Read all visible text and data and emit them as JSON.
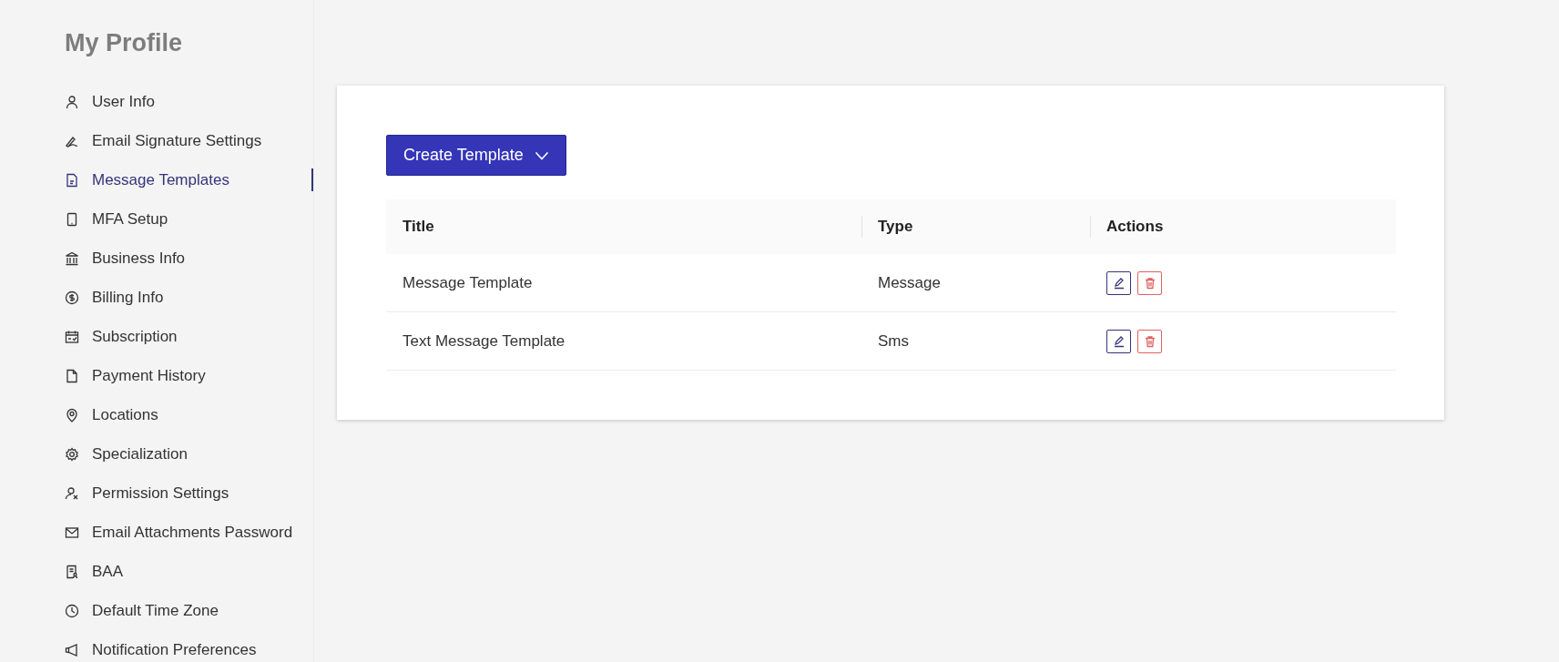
{
  "page_title": "My Profile",
  "sidebar": {
    "items": [
      {
        "label": "User Info",
        "selected": false
      },
      {
        "label": "Email Signature Settings",
        "selected": false
      },
      {
        "label": "Message Templates",
        "selected": true
      },
      {
        "label": "MFA Setup",
        "selected": false
      },
      {
        "label": "Business Info",
        "selected": false
      },
      {
        "label": "Billing Info",
        "selected": false
      },
      {
        "label": "Subscription",
        "selected": false
      },
      {
        "label": "Payment History",
        "selected": false
      },
      {
        "label": "Locations",
        "selected": false
      },
      {
        "label": "Specialization",
        "selected": false
      },
      {
        "label": "Permission Settings",
        "selected": false
      },
      {
        "label": "Email Attachments Password",
        "selected": false
      },
      {
        "label": "BAA",
        "selected": false
      },
      {
        "label": "Default Time Zone",
        "selected": false
      },
      {
        "label": "Notification Preferences",
        "selected": false
      }
    ]
  },
  "create_button": {
    "label": "Create Template"
  },
  "table": {
    "columns": [
      "Title",
      "Type",
      "Actions"
    ],
    "rows": [
      {
        "title": "Message Template",
        "type": "Message"
      },
      {
        "title": "Text Message Template",
        "type": "Sms"
      }
    ]
  }
}
